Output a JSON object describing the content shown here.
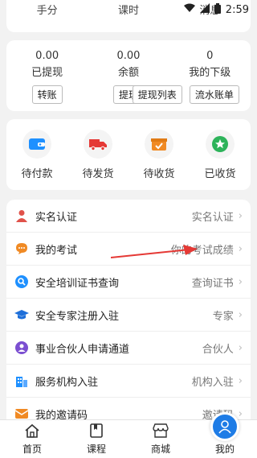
{
  "status_bar": {
    "time": "2:59"
  },
  "top_cut": [
    "手分",
    "课时",
    "消息"
  ],
  "finance": [
    {
      "value": "0.00",
      "label": "已提现",
      "button": "转账"
    },
    {
      "value": "0.00",
      "label": "余额",
      "button": "提现"
    },
    {
      "value": "0",
      "label": "我的下级",
      "button": "提现列表"
    }
  ],
  "finance_extra_button": "流水账单",
  "orders": [
    {
      "label": "待付款",
      "icon": "wallet-icon",
      "color": "#1e90ff"
    },
    {
      "label": "待发货",
      "icon": "truck-icon",
      "color": "#e53935"
    },
    {
      "label": "待收货",
      "icon": "package-icon",
      "color": "#f08a24"
    },
    {
      "label": "已收货",
      "icon": "star-badge-icon",
      "color": "#2db35a"
    }
  ],
  "menu": [
    {
      "label": "实名认证",
      "value": "实名认证",
      "icon": "person-icon",
      "color": "#e0524a"
    },
    {
      "label": "我的考试",
      "value": "你的考试成绩",
      "icon": "chat-bubble-icon",
      "color": "#f08a24"
    },
    {
      "label": "安全培训证书查询",
      "value": "查询证书",
      "icon": "search-icon",
      "color": "#1e90ff"
    },
    {
      "label": "安全专家注册入驻",
      "value": "专家",
      "icon": "graduation-cap-icon",
      "color": "#1e6fd9"
    },
    {
      "label": "事业合伙人申请通道",
      "value": "合伙人",
      "icon": "partner-icon",
      "color": "#7b4fd1"
    },
    {
      "label": "服务机构入驻",
      "value": "机构入驻",
      "icon": "building-icon",
      "color": "#1e90ff"
    },
    {
      "label": "我的邀请码",
      "value": "邀请码",
      "icon": "mail-icon",
      "color": "#f08a24"
    }
  ],
  "bottom_nav": [
    {
      "label": "首页",
      "icon": "home-icon"
    },
    {
      "label": "课程",
      "icon": "book-icon"
    },
    {
      "label": "商城",
      "icon": "shop-icon"
    },
    {
      "label": "我的",
      "icon": "user-icon"
    }
  ],
  "colors": {
    "accent": "#1e7ce6",
    "annotation": "#e53935"
  }
}
